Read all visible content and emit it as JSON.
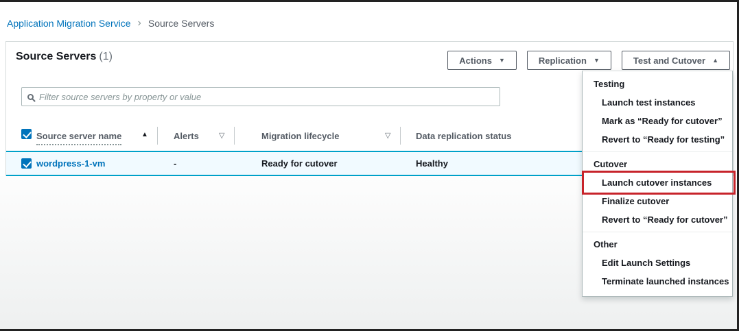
{
  "breadcrumb": {
    "root": "Application Migration Service",
    "current": "Source Servers",
    "separator": "›"
  },
  "header": {
    "title": "Source Servers",
    "count": "(1)"
  },
  "toolbar": {
    "buttons": [
      {
        "label": "Actions",
        "arrow": "▼",
        "state": "closed"
      },
      {
        "label": "Replication",
        "arrow": "▼",
        "state": "closed"
      },
      {
        "label": "Test and Cutover",
        "arrow": "▲",
        "state": "open"
      }
    ]
  },
  "filter": {
    "placeholder": "Filter source servers by property or value"
  },
  "table": {
    "columns": [
      {
        "label": "Source server name",
        "sort_icon": "▲",
        "sorted": "ascending"
      },
      {
        "label": "Alerts",
        "sort_icon": "▽",
        "sorted": "none"
      },
      {
        "label": "Migration lifecycle",
        "sort_icon": "▽",
        "sorted": "none"
      },
      {
        "label": "Data replication status"
      }
    ],
    "rows": [
      {
        "name": "wordpress-1-vm",
        "alerts": "-",
        "lifecycle": "Ready for cutover",
        "replication": "Healthy",
        "selected": true
      }
    ]
  },
  "dropdown": {
    "sections": [
      {
        "header": "Testing",
        "items": [
          {
            "label": "Launch test instances"
          },
          {
            "label": "Mark as “Ready for cutover”"
          },
          {
            "label": "Revert to “Ready for testing”"
          }
        ]
      },
      {
        "header": "Cutover",
        "items": [
          {
            "label": "Launch cutover instances",
            "highlighted": true
          },
          {
            "label": "Finalize cutover"
          },
          {
            "label": "Revert to “Ready for cutover”"
          }
        ]
      },
      {
        "header": "Other",
        "items": [
          {
            "label": "Edit Launch Settings"
          },
          {
            "label": "Terminate launched instances"
          }
        ]
      }
    ]
  },
  "colors": {
    "link_blue": "#0073bb",
    "selected_row_border": "#00a1c9",
    "selected_row_bg": "#f1faff",
    "annotation_red": "#c7232a",
    "button_border": "#545b64"
  }
}
